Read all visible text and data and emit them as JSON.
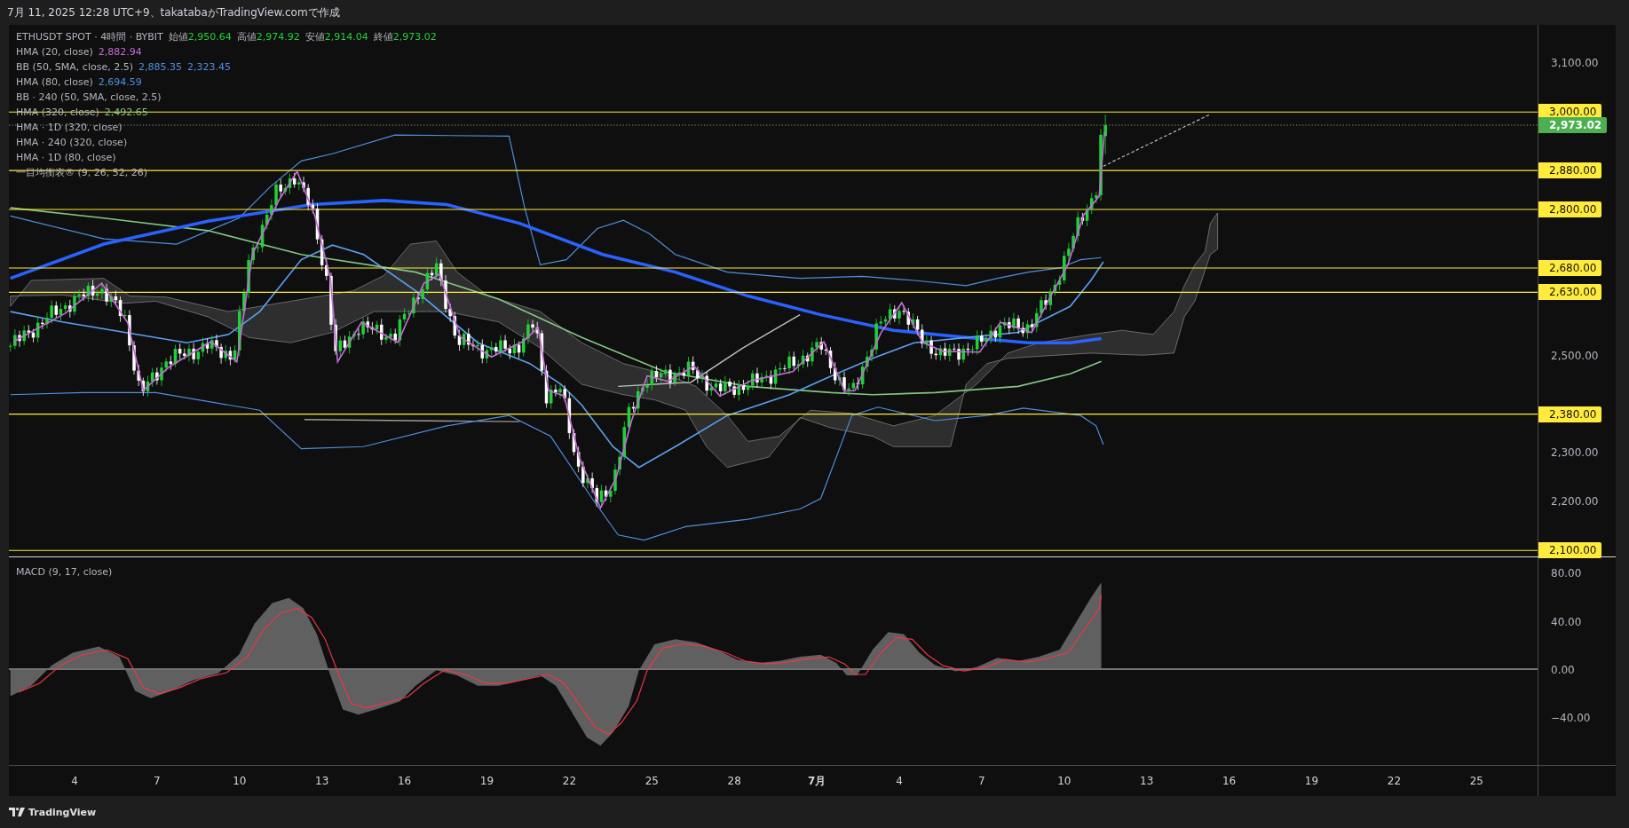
{
  "header": {
    "text": "7月 11, 2025 12:28 UTC+9、takatabaがTradingView.comで作成"
  },
  "legend": {
    "symbol": "ETHUSDT SPOT · 4時間 · BYBIT",
    "ohlc": [
      {
        "label": "始値",
        "value": "2,950.64"
      },
      {
        "label": "高値",
        "value": "2,974.92"
      },
      {
        "label": "安値",
        "value": "2,914.04"
      },
      {
        "label": "終値",
        "value": "2,973.02"
      }
    ],
    "indicators": [
      {
        "label": "HMA (20, close)",
        "values": [
          {
            "text": "2,882.94",
            "color": "#c56cd6"
          }
        ]
      },
      {
        "label": "BB (50, SMA, close, 2.5)",
        "values": [
          {
            "text": "2,885.35",
            "color": "#4d90e0"
          },
          {
            "text": "2,323.45",
            "color": "#4d90e0"
          }
        ]
      },
      {
        "label": "HMA (80, close)",
        "values": [
          {
            "text": "2,694.59",
            "color": "#4d90e0"
          }
        ]
      },
      {
        "label": "BB · 240 (50, SMA, close, 2.5)"
      },
      {
        "label": "HMA (320, close)",
        "values": [
          {
            "text": "2,492.65",
            "color": "#81c784"
          }
        ]
      },
      {
        "label": "HMA · 1D (320, close)"
      },
      {
        "label": "HMA · 240 (320, close)"
      },
      {
        "label": "HMA · 1D (80, close)"
      },
      {
        "label": "一目均衡表® (9, 26, 52, 26)"
      }
    ]
  },
  "price_axis": {
    "ticks": [
      "3,100.00",
      "2,500.00",
      "2,300.00",
      "2,200.00"
    ],
    "levels": [
      {
        "text": "3,000.00",
        "kind": "level"
      },
      {
        "text": "2,973.02",
        "kind": "last"
      },
      {
        "text": "2,880.00",
        "kind": "level"
      },
      {
        "text": "2,800.00",
        "kind": "level"
      },
      {
        "text": "2,680.00",
        "kind": "level"
      },
      {
        "text": "2,630.00",
        "kind": "level"
      },
      {
        "text": "2,380.00",
        "kind": "level"
      },
      {
        "text": "2,100.00",
        "kind": "level"
      }
    ]
  },
  "macd": {
    "label": "MACD (9, 17, close)",
    "ticks": [
      "80.00",
      "40.00",
      "0.00",
      "−40.00"
    ]
  },
  "time_axis": [
    {
      "text": "4",
      "kind": "day"
    },
    {
      "text": "7",
      "kind": "day"
    },
    {
      "text": "10",
      "kind": "day"
    },
    {
      "text": "13",
      "kind": "day"
    },
    {
      "text": "16",
      "kind": "day"
    },
    {
      "text": "19",
      "kind": "day"
    },
    {
      "text": "22",
      "kind": "day"
    },
    {
      "text": "25",
      "kind": "day"
    },
    {
      "text": "28",
      "kind": "day"
    },
    {
      "text": "7月",
      "kind": "month"
    },
    {
      "text": "4",
      "kind": "day"
    },
    {
      "text": "7",
      "kind": "day"
    },
    {
      "text": "10",
      "kind": "day"
    },
    {
      "text": "13",
      "kind": "day"
    },
    {
      "text": "16",
      "kind": "day"
    },
    {
      "text": "19",
      "kind": "day"
    },
    {
      "text": "22",
      "kind": "day"
    },
    {
      "text": "25",
      "kind": "day"
    }
  ],
  "footer": {
    "brand": "TradingView"
  }
}
